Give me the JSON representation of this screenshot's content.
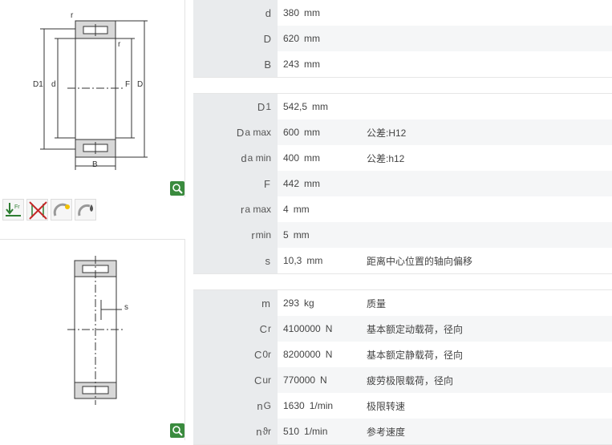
{
  "drawing": {
    "top_labels": [
      "r",
      "r",
      "D1",
      "d",
      "F",
      "D",
      "B"
    ],
    "bottom_labels": [
      "s"
    ]
  },
  "groups": [
    [
      {
        "sym": "d",
        "sub": "",
        "value": "380",
        "unit": "mm",
        "desc": ""
      },
      {
        "sym": "D",
        "sub": "",
        "value": "620",
        "unit": "mm",
        "desc": ""
      },
      {
        "sym": "B",
        "sub": "",
        "value": "243",
        "unit": "mm",
        "desc": ""
      }
    ],
    [
      {
        "sym": "D",
        "sub": "1",
        "value": "542,5",
        "unit": "mm",
        "desc": ""
      },
      {
        "sym": "D",
        "sub": "a max",
        "value": "600",
        "unit": "mm",
        "desc": "公差:H12"
      },
      {
        "sym": "d",
        "sub": "a min",
        "value": "400",
        "unit": "mm",
        "desc": "公差:h12"
      },
      {
        "sym": "F",
        "sub": "",
        "value": "442",
        "unit": "mm",
        "desc": ""
      },
      {
        "sym": "r",
        "sub": "a max",
        "value": "4",
        "unit": "mm",
        "desc": ""
      },
      {
        "sym": "r",
        "sub": "min",
        "value": "5",
        "unit": "mm",
        "desc": ""
      },
      {
        "sym": "s",
        "sub": "",
        "value": "10,3",
        "unit": "mm",
        "desc": "距离中心位置的轴向偏移"
      }
    ],
    [
      {
        "sym": "m",
        "sub": "",
        "value": "293",
        "unit": "kg",
        "desc": "质量"
      },
      {
        "sym": "C",
        "sub": "r",
        "value": "4100000",
        "unit": "N",
        "desc": "基本额定动载荷，径向"
      },
      {
        "sym": "C",
        "sub": "0r",
        "value": "8200000",
        "unit": "N",
        "desc": "基本额定静载荷，径向"
      },
      {
        "sym": "C",
        "sub": "ur",
        "value": "770000",
        "unit": "N",
        "desc": "疲劳极限载荷，径向"
      },
      {
        "sym": "n",
        "sub": "G",
        "value": "1630",
        "unit": "1/min",
        "desc": "极限转速"
      },
      {
        "sym": "n",
        "sub": "ϑr",
        "value": "510",
        "unit": "1/min",
        "desc": "参考速度"
      }
    ]
  ]
}
